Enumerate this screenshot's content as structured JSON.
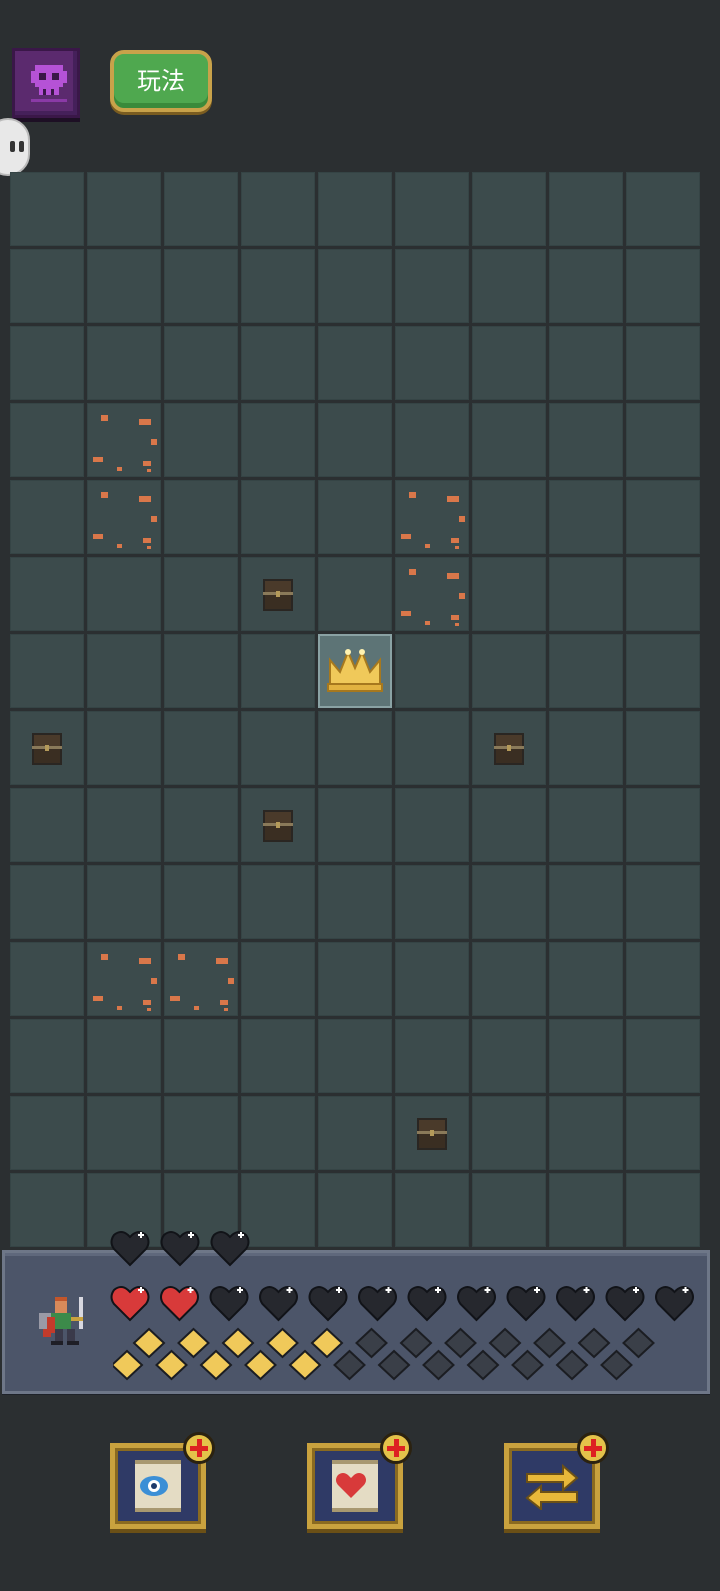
{
  "header": {
    "howto_label": "玩法",
    "skull_icon": "skull-book-icon"
  },
  "board": {
    "cols": 9,
    "rows": 14,
    "highlight": {
      "row": 6,
      "col": 4,
      "item": "crown-icon"
    },
    "chests": [
      {
        "row": 5,
        "col": 3
      },
      {
        "row": 7,
        "col": 0
      },
      {
        "row": 7,
        "col": 6
      },
      {
        "row": 8,
        "col": 3
      },
      {
        "row": 12,
        "col": 5
      }
    ],
    "rubble": [
      {
        "row": 3,
        "col": 1
      },
      {
        "row": 4,
        "col": 1
      },
      {
        "row": 4,
        "col": 5
      },
      {
        "row": 5,
        "col": 5
      },
      {
        "row": 10,
        "col": 1
      },
      {
        "row": 10,
        "col": 2
      }
    ]
  },
  "status": {
    "armor_hearts_total": 3,
    "armor_hearts_filled": 0,
    "life_hearts_total": 12,
    "life_hearts_filled": 2,
    "gems_total": 24,
    "gems_filled": 10,
    "colors": {
      "heart_red": "#d83a3a",
      "heart_empty": "#26282e",
      "gem_gold": "#f0c95a",
      "gem_empty": "#3a3f48"
    }
  },
  "tools": [
    {
      "name": "reveal-eye-scroll",
      "icon": "eye-icon"
    },
    {
      "name": "heal-heart-scroll",
      "icon": "heart-icon"
    },
    {
      "name": "swap-arrows-scroll",
      "icon": "swap-arrows-icon"
    }
  ]
}
